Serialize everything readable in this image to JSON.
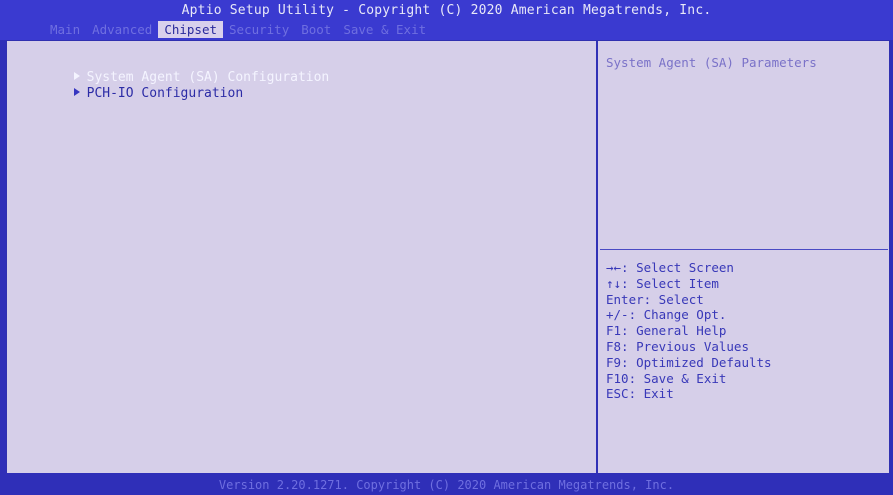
{
  "header": {
    "title": "Aptio Setup Utility - Copyright (C) 2020 American Megatrends, Inc.",
    "tabs": [
      {
        "label": "Main"
      },
      {
        "label": "Advanced"
      },
      {
        "label": "Chipset"
      },
      {
        "label": "Security"
      },
      {
        "label": "Boot"
      },
      {
        "label": "Save & Exit"
      }
    ],
    "active_tab": "Chipset"
  },
  "menu": {
    "items": [
      {
        "label": "System Agent (SA) Configuration",
        "selected": true,
        "icon": "submenu-arrow-icon"
      },
      {
        "label": "PCH-IO Configuration",
        "selected": false,
        "icon": "submenu-arrow-icon"
      }
    ]
  },
  "help": {
    "description": "System Agent (SA) Parameters",
    "keys": [
      "→←: Select Screen",
      "↑↓: Select Item",
      "Enter: Select",
      "+/-: Change Opt.",
      "F1: General Help",
      "F8: Previous Values",
      "F9: Optimized Defaults",
      "F10: Save & Exit",
      "ESC: Exit"
    ]
  },
  "footer": {
    "text": "Version 2.20.1271. Copyright (C) 2020 American Megatrends, Inc."
  },
  "colors": {
    "background": "#2f2fb8",
    "panel": "#d6cfe9",
    "selected_text": "#f4f4ff",
    "menu_text": "#2c2ca6",
    "inactive_tab": "#6f6fe0"
  }
}
